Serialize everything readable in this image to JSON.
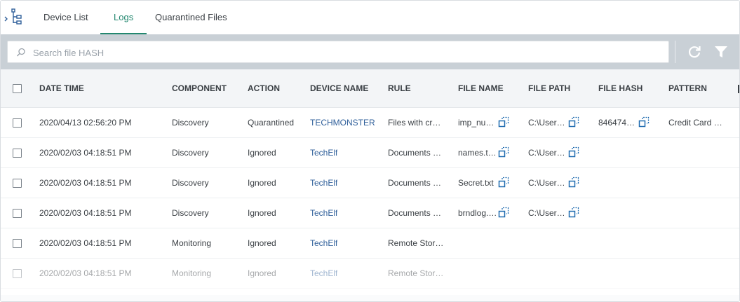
{
  "tabs": [
    {
      "label": "Device List",
      "active": false
    },
    {
      "label": "Logs",
      "active": true
    },
    {
      "label": "Quarantined Files",
      "active": false
    }
  ],
  "search": {
    "placeholder": "Search file HASH",
    "value": ""
  },
  "toolbar_icons": [
    "tree-icon",
    "search-icon",
    "refresh-icon",
    "filter-icon"
  ],
  "colors": {
    "accent": "#23876f",
    "toolbar": "#c9d0d6",
    "link": "#2f5f9a",
    "copy_icon": "#1f6bb0"
  },
  "table": {
    "headers": [
      "DATE TIME",
      "COMPONENT",
      "ACTION",
      "DEVICE NAME",
      "RULE",
      "FILE NAME",
      "FILE PATH",
      "FILE HASH",
      "PATTERN"
    ],
    "rows": [
      {
        "date": "2020/04/13 02:56:20 PM",
        "component": "Discovery",
        "action": "Quarantined",
        "device": "TECHMONSTER",
        "rule": "Files with cr…",
        "file_name": "imp_nu…",
        "file_path": "C:\\User…",
        "file_hash": "846474…",
        "pattern": "Credit Card …"
      },
      {
        "date": "2020/02/03 04:18:51 PM",
        "component": "Discovery",
        "action": "Ignored",
        "device": "TechElf",
        "rule": "Documents …",
        "file_name": "names.t…",
        "file_path": "C:\\User…",
        "file_hash": "",
        "pattern": ""
      },
      {
        "date": "2020/02/03 04:18:51 PM",
        "component": "Discovery",
        "action": "Ignored",
        "device": "TechElf",
        "rule": "Documents …",
        "file_name": "Secret.txt",
        "file_path": "C:\\User…",
        "file_hash": "",
        "pattern": ""
      },
      {
        "date": "2020/02/03 04:18:51 PM",
        "component": "Discovery",
        "action": "Ignored",
        "device": "TechElf",
        "rule": "Documents …",
        "file_name": "brndlog.…",
        "file_path": "C:\\User…",
        "file_hash": "",
        "pattern": ""
      },
      {
        "date": "2020/02/03 04:18:51 PM",
        "component": "Monitoring",
        "action": "Ignored",
        "device": "TechElf",
        "rule": "Remote Stor…",
        "file_name": "",
        "file_path": "",
        "file_hash": "",
        "pattern": ""
      },
      {
        "date": "2020/02/03 04:18:51 PM",
        "component": "Monitoring",
        "action": "Ignored",
        "device": "TechElf",
        "rule": "Remote Stor…",
        "file_name": "",
        "file_path": "",
        "file_hash": "",
        "pattern": ""
      }
    ]
  }
}
